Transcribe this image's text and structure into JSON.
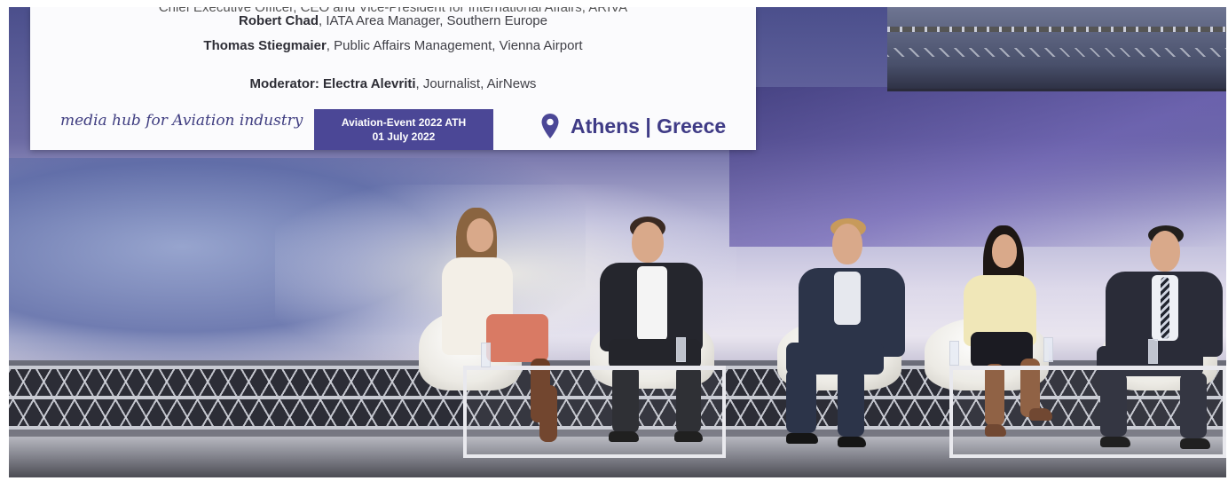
{
  "banner": {
    "line_top": "Chief Executive Officer, CEO and Vice-President for International Affairs, ARIVA",
    "speaker_1_name": "Robert Chad",
    "speaker_1_role": ", IATA Area Manager, Southern Europe",
    "speaker_2_name": "Thomas Stiegmaier",
    "speaker_2_role": ", Public Affairs Management, Vienna Airport",
    "moderator_label": "Moderator: Electra Alevriti",
    "moderator_role": ", Journalist, AirNews",
    "tagline": "media hub for Aviation industry",
    "event_line_1": "Aviation-Event 2022 ATH",
    "event_line_2": "01 July 2022",
    "location": "Athens | Greece",
    "icons": {
      "location": "map-pin-icon"
    },
    "colors": {
      "accent": "#4b4796",
      "text": "#3f3b86"
    }
  },
  "scene": {
    "panelists": [
      {
        "name": "moderator"
      },
      {
        "name": "panelist-2"
      },
      {
        "name": "panelist-3"
      },
      {
        "name": "panelist-4"
      },
      {
        "name": "panelist-5"
      }
    ]
  }
}
